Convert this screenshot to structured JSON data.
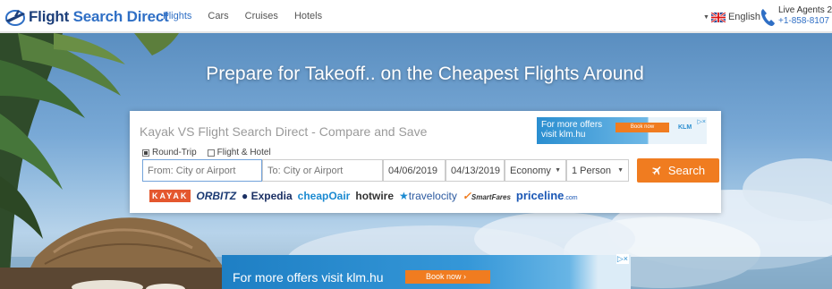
{
  "header": {
    "logo_text_a": "Flight ",
    "logo_text_b": "Search Direct",
    "nav": [
      "Flights",
      "Cars",
      "Cruises",
      "Hotels"
    ],
    "active_nav": "Flights",
    "language": "English",
    "agents_line1": "Live Agents 2",
    "agents_line2": "+1-858-8107"
  },
  "hero": {
    "title": "Prepare for Takeoff.. on the Cheapest Flights Around"
  },
  "search": {
    "title": "Kayak VS Flight Search Direct - Compare and Save",
    "trip_round": "Round-Trip",
    "trip_round_checked": true,
    "trip_flight_hotel": "Flight & Hotel",
    "trip_flight_hotel_checked": false,
    "from_placeholder": "From: City or Airport",
    "to_placeholder": "To: City or Airport",
    "depart_date": "04/06/2019",
    "return_date": "04/13/2019",
    "cabin": "Economy",
    "passengers": "1 Person",
    "search_label": "Search"
  },
  "partners": [
    "KAYAK",
    "ORBITZ",
    "Expedia",
    "cheapOair",
    "hotwire",
    "travelocity",
    "SmartFares",
    "priceline"
  ],
  "ads": {
    "mini_text_1": "For more offers",
    "mini_text_2": "visit klm.hu",
    "mini_button": "Book now",
    "mini_brand": "KLM",
    "big_text": "For more offers visit klm.hu",
    "big_button": "Book now",
    "ad_marker": "▷×"
  },
  "colors": {
    "brand_blue": "#2f6fc5",
    "accent_orange": "#f07c20"
  },
  "icons": [
    "logo-plane-icon",
    "flag-uk-icon",
    "phone-icon",
    "plane-icon",
    "ad-choices-icon"
  ]
}
